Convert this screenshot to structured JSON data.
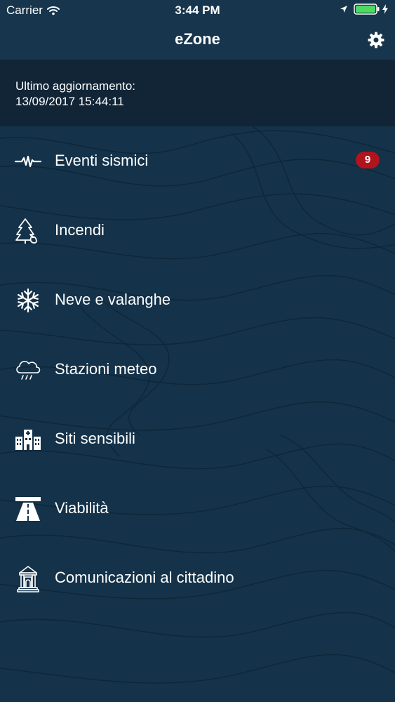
{
  "status_bar": {
    "carrier": "Carrier",
    "time": "3:44 PM"
  },
  "nav": {
    "title": "eZone"
  },
  "update": {
    "label": "Ultimo aggiornamento:",
    "timestamp": "13/09/2017 15:44:11"
  },
  "menu": {
    "items": [
      {
        "label": "Eventi sismici",
        "icon": "seismic-wave-icon",
        "badge": "9"
      },
      {
        "label": "Incendi",
        "icon": "forest-fire-icon"
      },
      {
        "label": "Neve e valanghe",
        "icon": "snowflake-icon"
      },
      {
        "label": "Stazioni meteo",
        "icon": "rain-cloud-icon"
      },
      {
        "label": "Siti sensibili",
        "icon": "buildings-icon"
      },
      {
        "label": "Viabilità",
        "icon": "highway-icon"
      },
      {
        "label": "Comunicazioni al cittadino",
        "icon": "town-hall-icon"
      }
    ]
  },
  "colors": {
    "background": "#143249",
    "header": "#17354c",
    "update_box": "#112537",
    "badge": "#b0141c",
    "battery": "#4cd964"
  }
}
